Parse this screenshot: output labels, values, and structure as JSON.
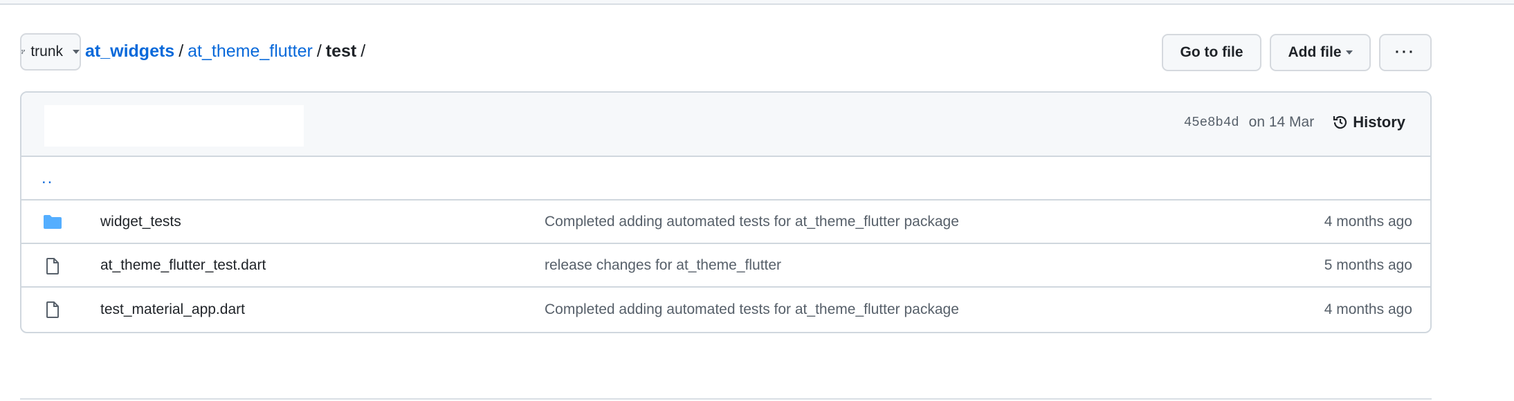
{
  "branch": {
    "name": "trunk",
    "icon": "git-branch-icon"
  },
  "breadcrumb": {
    "repo": "at_widgets",
    "dir": "at_theme_flutter",
    "current": "test",
    "sep": "/"
  },
  "actions": {
    "go_to_file": "Go to file",
    "add_file": "Add file",
    "more": "···"
  },
  "commit": {
    "sha": "45e8b4d",
    "date": "on 14 Mar",
    "history": "History"
  },
  "parent_dir": "..",
  "files": [
    {
      "type": "folder",
      "name": "widget_tests",
      "message": "Completed adding automated tests for at_theme_flutter package",
      "age": "4 months ago"
    },
    {
      "type": "file",
      "name": "at_theme_flutter_test.dart",
      "message": "release changes for at_theme_flutter",
      "age": "5 months ago"
    },
    {
      "type": "file",
      "name": "test_material_app.dart",
      "message": "Completed adding automated tests for at_theme_flutter package",
      "age": "4 months ago"
    }
  ],
  "colors": {
    "link": "#0969da",
    "folder": "#54aeff",
    "muted": "#57606a"
  }
}
